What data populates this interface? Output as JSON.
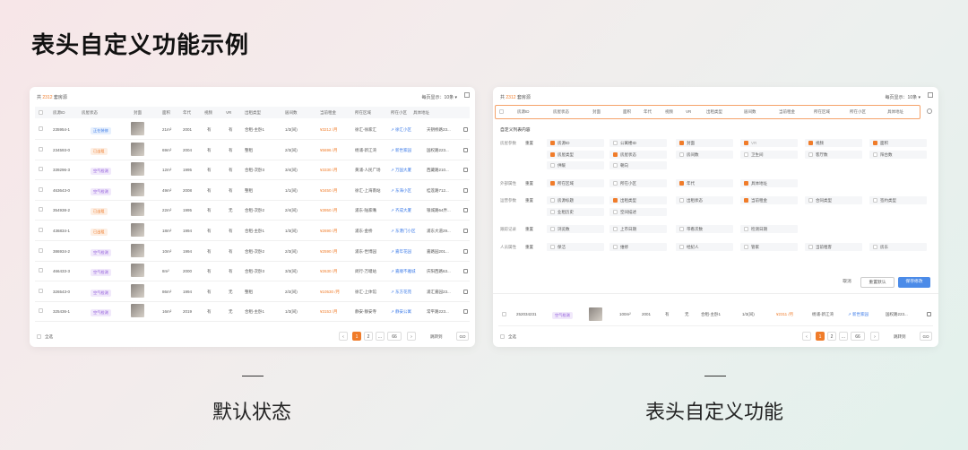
{
  "title": "表头自定义功能示例",
  "captions": {
    "left": "默认状态",
    "right": "表头自定义功能"
  },
  "colors": {
    "accent": "#f07c2a",
    "link": "#3b7ae8",
    "primary_button": "#4b8be8"
  },
  "left": {
    "summary_prefix": "共",
    "summary_count": "2312",
    "summary_suffix": "套房源",
    "per_page": "每页显示：10条 ▾",
    "headers": [
      "房源ID",
      "房屋状态",
      "封面",
      "面积",
      "年代",
      "视频",
      "VR",
      "出租类型",
      "居间数",
      "当前租金",
      "所在区域",
      "所在小区",
      "具体地址"
    ],
    "rows": [
      {
        "id": "235954-1",
        "status": "正在装修",
        "tag": "blue",
        "area": "21m²",
        "year": "2001",
        "video": "有",
        "vr": "有",
        "type": "合租-主卧1",
        "rooms": "1/3(间)",
        "rent": "¥3212 /月",
        "region": "徐汇-徐家汇",
        "community": "↗ 徐汇小区",
        "addr": "天钥桥路23..."
      },
      {
        "id": "234593-0",
        "status": "已出租",
        "tag": "orange",
        "area": "69m²",
        "year": "2004",
        "video": "有",
        "vr": "有",
        "type": "整租",
        "rooms": "2/3(间)",
        "rent": "¥5696 /月",
        "region": "杨浦-新江湾",
        "community": "↗ 新世家园",
        "addr": "国权路223..."
      },
      {
        "id": "339296-3",
        "status": "空气检测",
        "tag": "purple",
        "area": "12m²",
        "year": "1995",
        "video": "有",
        "vr": "有",
        "type": "合租-次卧3",
        "rooms": "3/4(间)",
        "rent": "¥3330 /月",
        "region": "黄浦-人民广场",
        "community": "↗ 万国大厦",
        "addr": "西藏路210..."
      },
      {
        "id": "463643-0",
        "status": "空气检测",
        "tag": "purple",
        "area": "49m²",
        "year": "2008",
        "video": "有",
        "vr": "有",
        "type": "整租",
        "rooms": "1/1(间)",
        "rent": "¥3450 /月",
        "region": "徐汇-上海南站",
        "community": "↗ 东海小区",
        "addr": "桂莲路712..."
      },
      {
        "id": "354938-2",
        "status": "已出租",
        "tag": "orange",
        "area": "22m²",
        "year": "1995",
        "video": "有",
        "vr": "无",
        "type": "合租-次卧2",
        "rooms": "2/4(间)",
        "rent": "¥3950 /月",
        "region": "浦东-陆家嘴",
        "community": "↗ 齐成大厦",
        "addr": "银城路64弄..."
      },
      {
        "id": "436834-1",
        "status": "已出租",
        "tag": "orange",
        "area": "18m²",
        "year": "1994",
        "video": "有",
        "vr": "有",
        "type": "合租-主卧1",
        "rooms": "1/3(间)",
        "rent": "¥2690 /月",
        "region": "浦东-金桥",
        "community": "↗ 东港门小区",
        "addr": "浦东大道29..."
      },
      {
        "id": "386934-2",
        "status": "空气检测",
        "tag": "purple",
        "area": "10m²",
        "year": "1994",
        "video": "有",
        "vr": "有",
        "type": "合租-次卧2",
        "rooms": "2/3(间)",
        "rent": "¥2590 /月",
        "region": "浦东-世博园",
        "community": "↗ 嘉年花园",
        "addr": "嘉路园201..."
      },
      {
        "id": "466433-3",
        "status": "空气检测",
        "tag": "purple",
        "area": "8m²",
        "year": "2000",
        "video": "有",
        "vr": "有",
        "type": "合租-次卧3",
        "rooms": "3/3(间)",
        "rent": "¥2630 /月",
        "region": "闵行-万堰站",
        "community": "↗ 嘉顺不雅城",
        "addr": "庆阳西路63..."
      },
      {
        "id": "326543-0",
        "status": "空气检测",
        "tag": "purple",
        "area": "86m²",
        "year": "1994",
        "video": "有",
        "vr": "无",
        "type": "整租",
        "rooms": "2/2(间)",
        "rent": "¥10530 /月",
        "region": "徐汇-上体馆",
        "community": "↗ 东方花苑",
        "addr": "浦汇嘉园23..."
      },
      {
        "id": "325436-1",
        "status": "空气检测",
        "tag": "purple",
        "area": "16m²",
        "year": "2019",
        "video": "有",
        "vr": "无",
        "type": "合租-主卧1",
        "rooms": "1/3(间)",
        "rent": "¥3153 /月",
        "region": "静安-静安寺",
        "community": "↗ 静安公寓",
        "addr": "常平路223..."
      }
    ],
    "select_all": "全选",
    "pages": [
      "‹",
      "1",
      "2",
      "...",
      "66",
      "›"
    ],
    "jump_label": "跳转到",
    "go_label": "GO"
  },
  "right": {
    "summary_prefix": "共",
    "summary_count": "2312",
    "summary_suffix": "套房源",
    "per_page": "每页显示：10条 ▾",
    "headers": [
      "房源ID",
      "房屋状态",
      "封面",
      "面积",
      "年代",
      "视频",
      "VR",
      "出租类型",
      "居间数",
      "当前租金",
      "所在区域",
      "所在小区",
      "具体地址"
    ],
    "config_title": "自定义列表内容",
    "sections": [
      {
        "label": "房屋参数",
        "all": "重置",
        "rows": [
          [
            {
              "t": "房源ID",
              "on": true
            },
            {
              "t": "公寓楼ID",
              "on": false
            },
            {
              "t": "封面",
              "on": true
            },
            {
              "t": "VR",
              "on": true,
              "dis": true
            },
            {
              "t": "视频",
              "on": true
            },
            {
              "t": "面积",
              "on": true
            }
          ],
          [
            {
              "t": "房屋类型",
              "on": true
            },
            {
              "t": "房屋状态",
              "on": true
            },
            {
              "t": "房间数",
              "on": false
            },
            {
              "t": "卫生间",
              "on": false
            },
            {
              "t": "客厅数",
              "on": false
            },
            {
              "t": "阳台数",
              "on": false
            }
          ],
          [
            {
              "t": "供暖",
              "on": false
            },
            {
              "t": "朝向",
              "on": false
            }
          ]
        ]
      },
      {
        "label": "外部属性",
        "all": "重置",
        "rows": [
          [
            {
              "t": "所在区域",
              "on": true
            },
            {
              "t": "所在小区",
              "on": false
            },
            {
              "t": "年代",
              "on": true
            },
            {
              "t": "具体地址",
              "on": true
            }
          ]
        ]
      },
      {
        "label": "运营参数",
        "all": "重置",
        "rows": [
          [
            {
              "t": "房源标题",
              "on": false
            },
            {
              "t": "出租类型",
              "on": true
            },
            {
              "t": "出租状态",
              "on": false
            },
            {
              "t": "当前租金",
              "on": true
            },
            {
              "t": "合同类型",
              "on": false
            },
            {
              "t": "签约类型",
              "on": false
            }
          ],
          [
            {
              "t": "业租历史",
              "on": false
            },
            {
              "t": "空间描述",
              "on": false
            }
          ]
        ]
      },
      {
        "label": "跟踪记录",
        "all": "重置",
        "rows": [
          [
            {
              "t": "浏览数",
              "on": false
            },
            {
              "t": "上市日期",
              "on": false
            },
            {
              "t": "带看次数",
              "on": false
            },
            {
              "t": "检测日期",
              "on": false
            }
          ]
        ]
      },
      {
        "label": "人员属性",
        "all": "重置",
        "rows": [
          [
            {
              "t": "保洁",
              "on": false
            },
            {
              "t": "维修",
              "on": false
            },
            {
              "t": "经纪人",
              "on": false
            },
            {
              "t": "管家",
              "on": false
            },
            {
              "t": "当前租客",
              "on": false
            },
            {
              "t": "房东",
              "on": false
            }
          ]
        ]
      }
    ],
    "buttons": {
      "cancel": "取消",
      "reset": "重置默认",
      "save": "保存修改"
    },
    "visible_row": {
      "id": "252034231",
      "status": "空气检测",
      "area": "100m²",
      "year": "2001",
      "video": "有",
      "vr": "无",
      "type": "合租-主卧1",
      "rooms": "1/3(间)",
      "rent": "¥2311 /月",
      "region": "杨浦-新江湾",
      "community": "↗ 新世家园",
      "addr": "国权路223..."
    },
    "select_all": "全选",
    "pages": [
      "‹",
      "1",
      "2",
      "...",
      "66",
      "›"
    ],
    "jump_label": "跳转到",
    "go_label": "GO"
  }
}
